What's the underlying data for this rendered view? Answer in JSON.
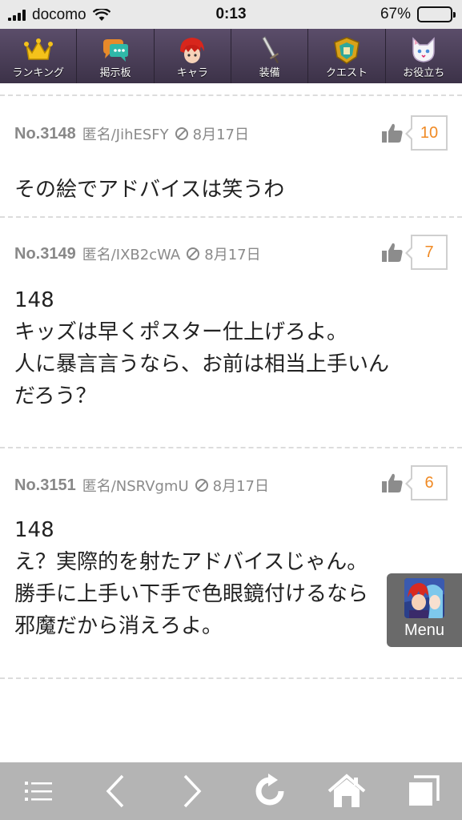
{
  "status": {
    "carrier": "docomo",
    "time": "0:13",
    "battery": "67%",
    "battery_level": 0.67
  },
  "topnav": {
    "tabs": [
      {
        "label": "ランキング",
        "icon": "crown-icon"
      },
      {
        "label": "掲示板",
        "icon": "chat-bubble-icon"
      },
      {
        "label": "キャラ",
        "icon": "character-icon"
      },
      {
        "label": "装備",
        "icon": "sword-icon"
      },
      {
        "label": "クエスト",
        "icon": "quest-emblem-icon"
      },
      {
        "label": "お役立ち",
        "icon": "cat-helper-icon"
      }
    ]
  },
  "posts": [
    {
      "no": "No.3148",
      "author": "匿名/JihESFY",
      "date": "8月17日",
      "likes": "10",
      "lines": [
        "その絵でアドバイスは笑うわ"
      ]
    },
    {
      "no": "No.3149",
      "author": "匿名/IXB2cWA",
      "date": "8月17日",
      "likes": "7",
      "lines": [
        "148",
        "キッズは早くポスター仕上げろよ。",
        "人に暴言言うなら、お前は相当上手いん",
        "だろう？"
      ]
    },
    {
      "no": "No.3151",
      "author": "匿名/NSRVgmU",
      "date": "8月17日",
      "likes": "6",
      "lines": [
        "148",
        "え？実際的を射たアドバイスじゃん。",
        "勝手に上手い下手で色眼鏡付けるなら",
        "邪魔だから消えろよ。"
      ]
    }
  ],
  "floating_menu": {
    "label": "Menu"
  },
  "toolbar": {
    "icons": [
      "list-icon",
      "back-arrow-icon",
      "forward-arrow-icon",
      "reload-icon",
      "home-icon",
      "tabs-icon"
    ]
  },
  "colors": {
    "accent": "#f08a24",
    "nav_bg": "#4a3f58",
    "toolbar_bg": "#b4b4b4"
  }
}
